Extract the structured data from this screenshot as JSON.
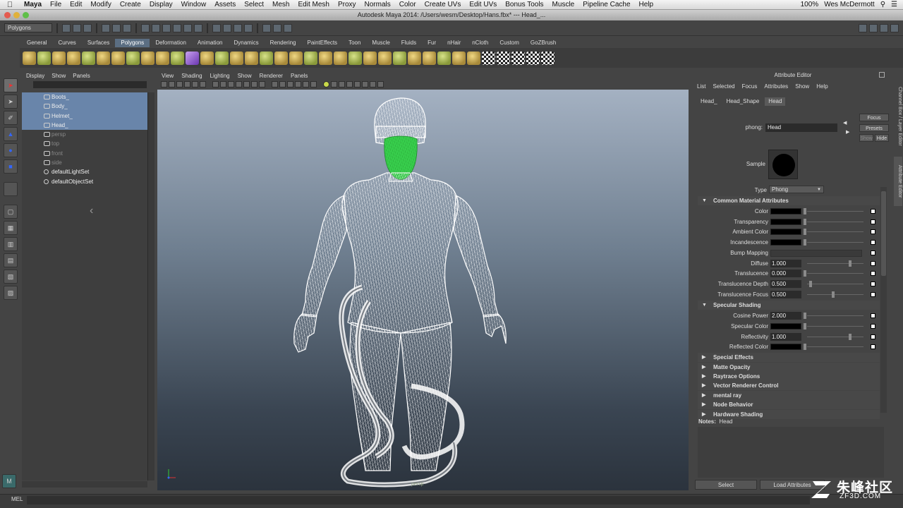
{
  "menubar": {
    "app": "Maya",
    "items": [
      "File",
      "Edit",
      "Modify",
      "Create",
      "Display",
      "Window",
      "Assets",
      "Select",
      "Mesh",
      "Edit Mesh",
      "Proxy",
      "Normals",
      "Color",
      "Create UVs",
      "Edit UVs",
      "Bonus Tools",
      "Muscle",
      "Pipeline Cache",
      "Help"
    ],
    "battery": "100%",
    "user": "Wes McDermott"
  },
  "window": {
    "title": "Autodesk Maya 2014: /Users/wesm/Desktop/Hans.fbx*   ---   Head_..."
  },
  "statusline": {
    "mode": "Polygons"
  },
  "shelf": {
    "tabs": [
      "General",
      "Curves",
      "Surfaces",
      "Polygons",
      "Deformation",
      "Animation",
      "Dynamics",
      "Rendering",
      "PaintEffects",
      "Toon",
      "Muscle",
      "Fluids",
      "Fur",
      "nHair",
      "nCloth",
      "Custom",
      "GoZBrush"
    ],
    "active": "Polygons"
  },
  "outliner": {
    "menu": [
      "Display",
      "Show",
      "Panels"
    ],
    "items": [
      {
        "label": "Boots_",
        "state": "selected"
      },
      {
        "label": "Body_",
        "state": "selected"
      },
      {
        "label": "Helmet_",
        "state": "selected"
      },
      {
        "label": "Head_",
        "state": "selected"
      },
      {
        "label": "persp",
        "state": "dim"
      },
      {
        "label": "top",
        "state": "dim"
      },
      {
        "label": "front",
        "state": "dim"
      },
      {
        "label": "side",
        "state": "dim"
      },
      {
        "label": "defaultLightSet",
        "state": "normal"
      },
      {
        "label": "defaultObjectSet",
        "state": "normal"
      }
    ]
  },
  "viewport": {
    "menu": [
      "View",
      "Shading",
      "Lighting",
      "Show",
      "Renderer",
      "Panels"
    ],
    "camera": "persp",
    "colors": {
      "wire": "#ffffff",
      "selected_face": "#39d24e"
    }
  },
  "attribute_editor": {
    "title": "Attribute Editor",
    "menu": [
      "List",
      "Selected",
      "Focus",
      "Attributes",
      "Show",
      "Help"
    ],
    "tabs": [
      "Head_",
      "Head_Shape",
      "Head"
    ],
    "active_tab": "Head",
    "node_type_label": "phong:",
    "node_name": "Head",
    "buttons": {
      "focus": "Focus",
      "presets": "Presets",
      "show": "Show",
      "hide": "Hide"
    },
    "sample_label": "Sample",
    "type_label": "Type",
    "type_value": "Phong",
    "common_section": "Common Material Attributes",
    "common": [
      {
        "label": "Color",
        "kind": "color",
        "slider": 0.0
      },
      {
        "label": "Transparency",
        "kind": "color",
        "slider": 0.0
      },
      {
        "label": "Ambient Color",
        "kind": "color",
        "slider": 0.0
      },
      {
        "label": "Incandescence",
        "kind": "color",
        "slider": 0.0
      },
      {
        "label": "Bump Mapping",
        "kind": "bump"
      },
      {
        "label": "Diffuse",
        "kind": "value",
        "value": "1.000",
        "slider": 0.8
      },
      {
        "label": "Translucence",
        "kind": "value",
        "value": "0.000",
        "slider": 0.0
      },
      {
        "label": "Translucence Depth",
        "kind": "value",
        "value": "0.500",
        "slider": 0.1
      },
      {
        "label": "Translucence Focus",
        "kind": "value",
        "value": "0.500",
        "slider": 0.5
      }
    ],
    "specular_section": "Specular Shading",
    "specular": [
      {
        "label": "Cosine Power",
        "kind": "value",
        "value": "2.000",
        "slider": 0.0
      },
      {
        "label": "Specular Color",
        "kind": "color",
        "slider": 0.0
      },
      {
        "label": "Reflectivity",
        "kind": "value",
        "value": "1.000",
        "slider": 0.8
      },
      {
        "label": "Reflected Color",
        "kind": "color",
        "slider": 0.0
      }
    ],
    "collapsed_sections": [
      "Special Effects",
      "Matte Opacity",
      "Raytrace Options",
      "Vector Renderer Control",
      "mental ray",
      "Node Behavior",
      "Hardware Shading"
    ],
    "notes_label": "Notes:",
    "notes_value": "Head",
    "bottom_buttons": [
      "Select",
      "Load Attributes"
    ]
  },
  "side_tabs": [
    "Channel Box / Layer Editor",
    "Attribute Editor"
  ],
  "command_line": {
    "label": "MEL"
  },
  "watermark": {
    "cn": "朱峰社区",
    "en": "ZF3D.COM"
  }
}
